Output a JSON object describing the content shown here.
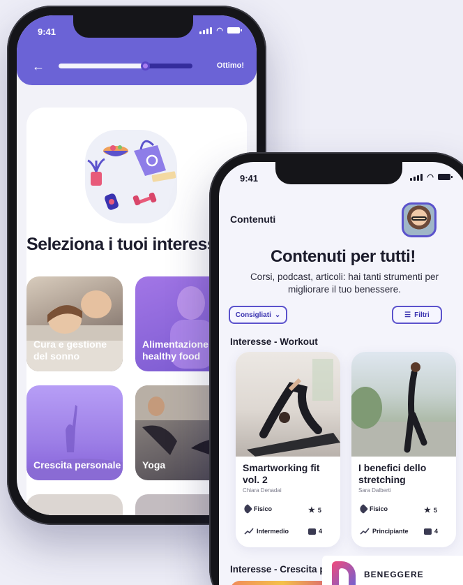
{
  "app_background": "#eeeef7",
  "accent_color": "#6b63d6",
  "onboarding_phone": {
    "status_time": "9:41",
    "progress_value": 0.65,
    "progress_label": "Ottimo!",
    "title": "Seleziona i tuoi interessi",
    "tiles": [
      {
        "label": "Cura e gestione del sonno"
      },
      {
        "label": "Alimentazione healthy food"
      },
      {
        "label": "Crescita personale"
      },
      {
        "label": "Yoga"
      }
    ]
  },
  "content_phone": {
    "status_time": "9:41",
    "page_title": "Contenuti",
    "hero_title": "Contenuti per tutti!",
    "hero_subtitle": "Corsi, podcast, articoli: hai tanti strumenti per migliorare il tuo benessere.",
    "sort_chip": "Consigliati",
    "filter_chip": "Filtri",
    "section_workout": "Interesse - Workout",
    "section_growth": "Interesse - Crescita personale",
    "cards": [
      {
        "title": "Smartworking fit vol. 2",
        "author": "Chiara Denadai",
        "category": "Fisico",
        "rating": "5",
        "level": "Intermedio",
        "videos": "4"
      },
      {
        "title": "I benefici dello stretching",
        "author": "Sara Dalberti",
        "category": "Fisico",
        "rating": "5",
        "level": "Principiante",
        "videos": "4"
      }
    ]
  },
  "brand": {
    "name": "BENEGGERE"
  }
}
